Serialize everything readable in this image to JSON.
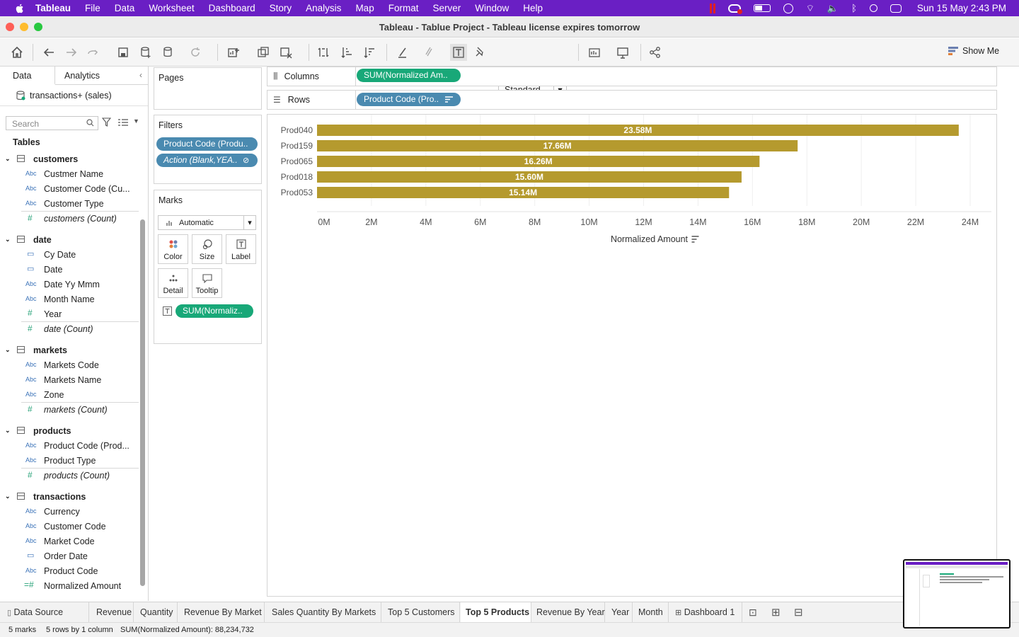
{
  "menubar": {
    "app": "Tableau",
    "items": [
      "File",
      "Data",
      "Worksheet",
      "Dashboard",
      "Story",
      "Analysis",
      "Map",
      "Format",
      "Server",
      "Window",
      "Help"
    ],
    "clock": "Sun 15 May  2:43 PM"
  },
  "window": {
    "title": "Tableau - Tablue Project - Tableau license expires tomorrow"
  },
  "toolbar": {
    "view_size": "Standard",
    "show_me": "Show Me"
  },
  "data_pane": {
    "tabs": [
      "Data",
      "Analytics"
    ],
    "datasource": "transactions+ (sales)",
    "search_placeholder": "Search",
    "tables_heading": "Tables",
    "groups": [
      {
        "name": "customers",
        "fields": [
          {
            "type": "Abc",
            "name": "Custmer Name"
          },
          {
            "type": "Abc",
            "name": "Customer Code (Cu..."
          },
          {
            "type": "Abc",
            "name": "Customer Type"
          }
        ],
        "count": "customers (Count)"
      },
      {
        "name": "date",
        "fields": [
          {
            "type": "cal",
            "name": "Cy Date"
          },
          {
            "type": "cal",
            "name": "Date"
          },
          {
            "type": "Abc",
            "name": "Date Yy Mmm"
          },
          {
            "type": "Abc",
            "name": "Month Name"
          },
          {
            "type": "#",
            "name": "Year"
          }
        ],
        "count": "date (Count)"
      },
      {
        "name": "markets",
        "fields": [
          {
            "type": "Abc",
            "name": "Markets Code"
          },
          {
            "type": "Abc",
            "name": "Markets Name"
          },
          {
            "type": "Abc",
            "name": "Zone"
          }
        ],
        "count": "markets (Count)"
      },
      {
        "name": "products",
        "fields": [
          {
            "type": "Abc",
            "name": "Product Code (Prod..."
          },
          {
            "type": "Abc",
            "name": "Product Type"
          }
        ],
        "count": "products (Count)"
      },
      {
        "name": "transactions",
        "fields": [
          {
            "type": "Abc",
            "name": "Currency"
          },
          {
            "type": "Abc",
            "name": "Customer Code"
          },
          {
            "type": "Abc",
            "name": "Market Code"
          },
          {
            "type": "cal",
            "name": "Order Date"
          },
          {
            "type": "Abc",
            "name": "Product Code"
          },
          {
            "type": "#=",
            "name": "Normalized Amount"
          }
        ],
        "count": ""
      }
    ]
  },
  "cards": {
    "pages": "Pages",
    "filters": "Filters",
    "filter_pills": [
      "Product Code (Produ..",
      "Action (Blank,YEA.."
    ],
    "marks": "Marks",
    "mark_type": "Automatic",
    "mark_buttons": [
      "Color",
      "Size",
      "Label",
      "Detail",
      "Tooltip"
    ],
    "mark_pill": "SUM(Normaliz.."
  },
  "shelves": {
    "columns_label": "Columns",
    "columns_pill": "SUM(Normalized Am..",
    "rows_label": "Rows",
    "rows_pill": "Product Code (Pro.."
  },
  "chart_data": {
    "type": "bar",
    "orientation": "horizontal",
    "categories": [
      "Prod040",
      "Prod159",
      "Prod065",
      "Prod018",
      "Prod053"
    ],
    "values": [
      23.58,
      17.66,
      16.26,
      15.6,
      15.14
    ],
    "data_labels": [
      "23.58M",
      "17.66M",
      "16.26M",
      "15.60M",
      "15.14M"
    ],
    "xlabel": "Normalized Amount",
    "xticks": [
      "0M",
      "2M",
      "4M",
      "6M",
      "8M",
      "10M",
      "12M",
      "14M",
      "16M",
      "18M",
      "20M",
      "22M",
      "24M"
    ],
    "xlim": [
      0,
      24
    ],
    "bar_color": "#b59a2e",
    "grid": true
  },
  "sheet_tabs": {
    "datasource": "Data Source",
    "tabs": [
      "Revenue",
      "Quantity",
      "Revenue By Market",
      "Sales Quantity By Markets",
      "Top 5 Customers",
      "Top 5 Products",
      "Revenue By Year",
      "Year",
      "Month",
      "Dashboard 1"
    ],
    "active": "Top 5 Products"
  },
  "status": {
    "marks": "5 marks",
    "rows": "5 rows by 1 column",
    "sum": "SUM(Normalized Amount): 88,234,732"
  }
}
